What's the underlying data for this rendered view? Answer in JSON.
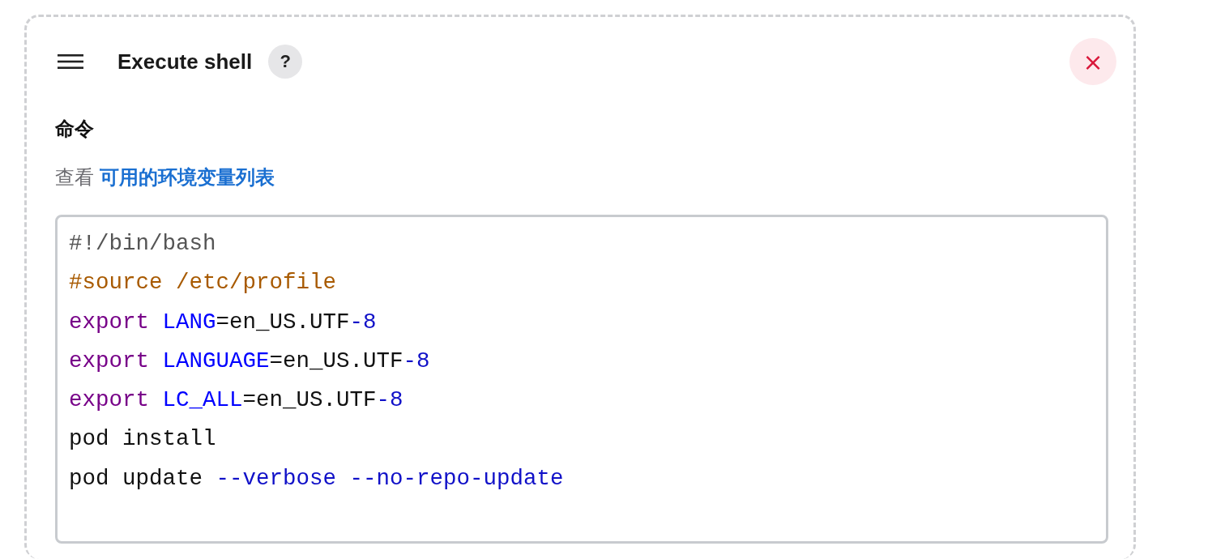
{
  "step": {
    "title": "Execute shell",
    "help": "?",
    "close": "×"
  },
  "field": {
    "label": "命令",
    "hint_prefix": "查看",
    "hint_link": "可用的环境变量列表"
  },
  "code": [
    [
      {
        "text": "#!/bin/bash",
        "kind": "meta"
      }
    ],
    [
      {
        "text": "#source /etc/profile",
        "kind": "comment"
      }
    ],
    [
      {
        "text": "export ",
        "kind": "keyword"
      },
      {
        "text": "LANG",
        "kind": "variable"
      },
      {
        "text": "=en_US.UTF",
        "kind": "plain"
      },
      {
        "text": "-8",
        "kind": "number"
      }
    ],
    [
      {
        "text": "export ",
        "kind": "keyword"
      },
      {
        "text": "LANGUAGE",
        "kind": "variable"
      },
      {
        "text": "=en_US.UTF",
        "kind": "plain"
      },
      {
        "text": "-8",
        "kind": "number"
      }
    ],
    [
      {
        "text": "export ",
        "kind": "keyword"
      },
      {
        "text": "LC_ALL",
        "kind": "variable"
      },
      {
        "text": "=en_US.UTF",
        "kind": "plain"
      },
      {
        "text": "-8",
        "kind": "number"
      }
    ],
    [
      {
        "text": "pod install",
        "kind": "plain"
      }
    ],
    [
      {
        "text": "pod update ",
        "kind": "plain"
      },
      {
        "text": "--verbose --no-repo-update",
        "kind": "option"
      }
    ]
  ]
}
